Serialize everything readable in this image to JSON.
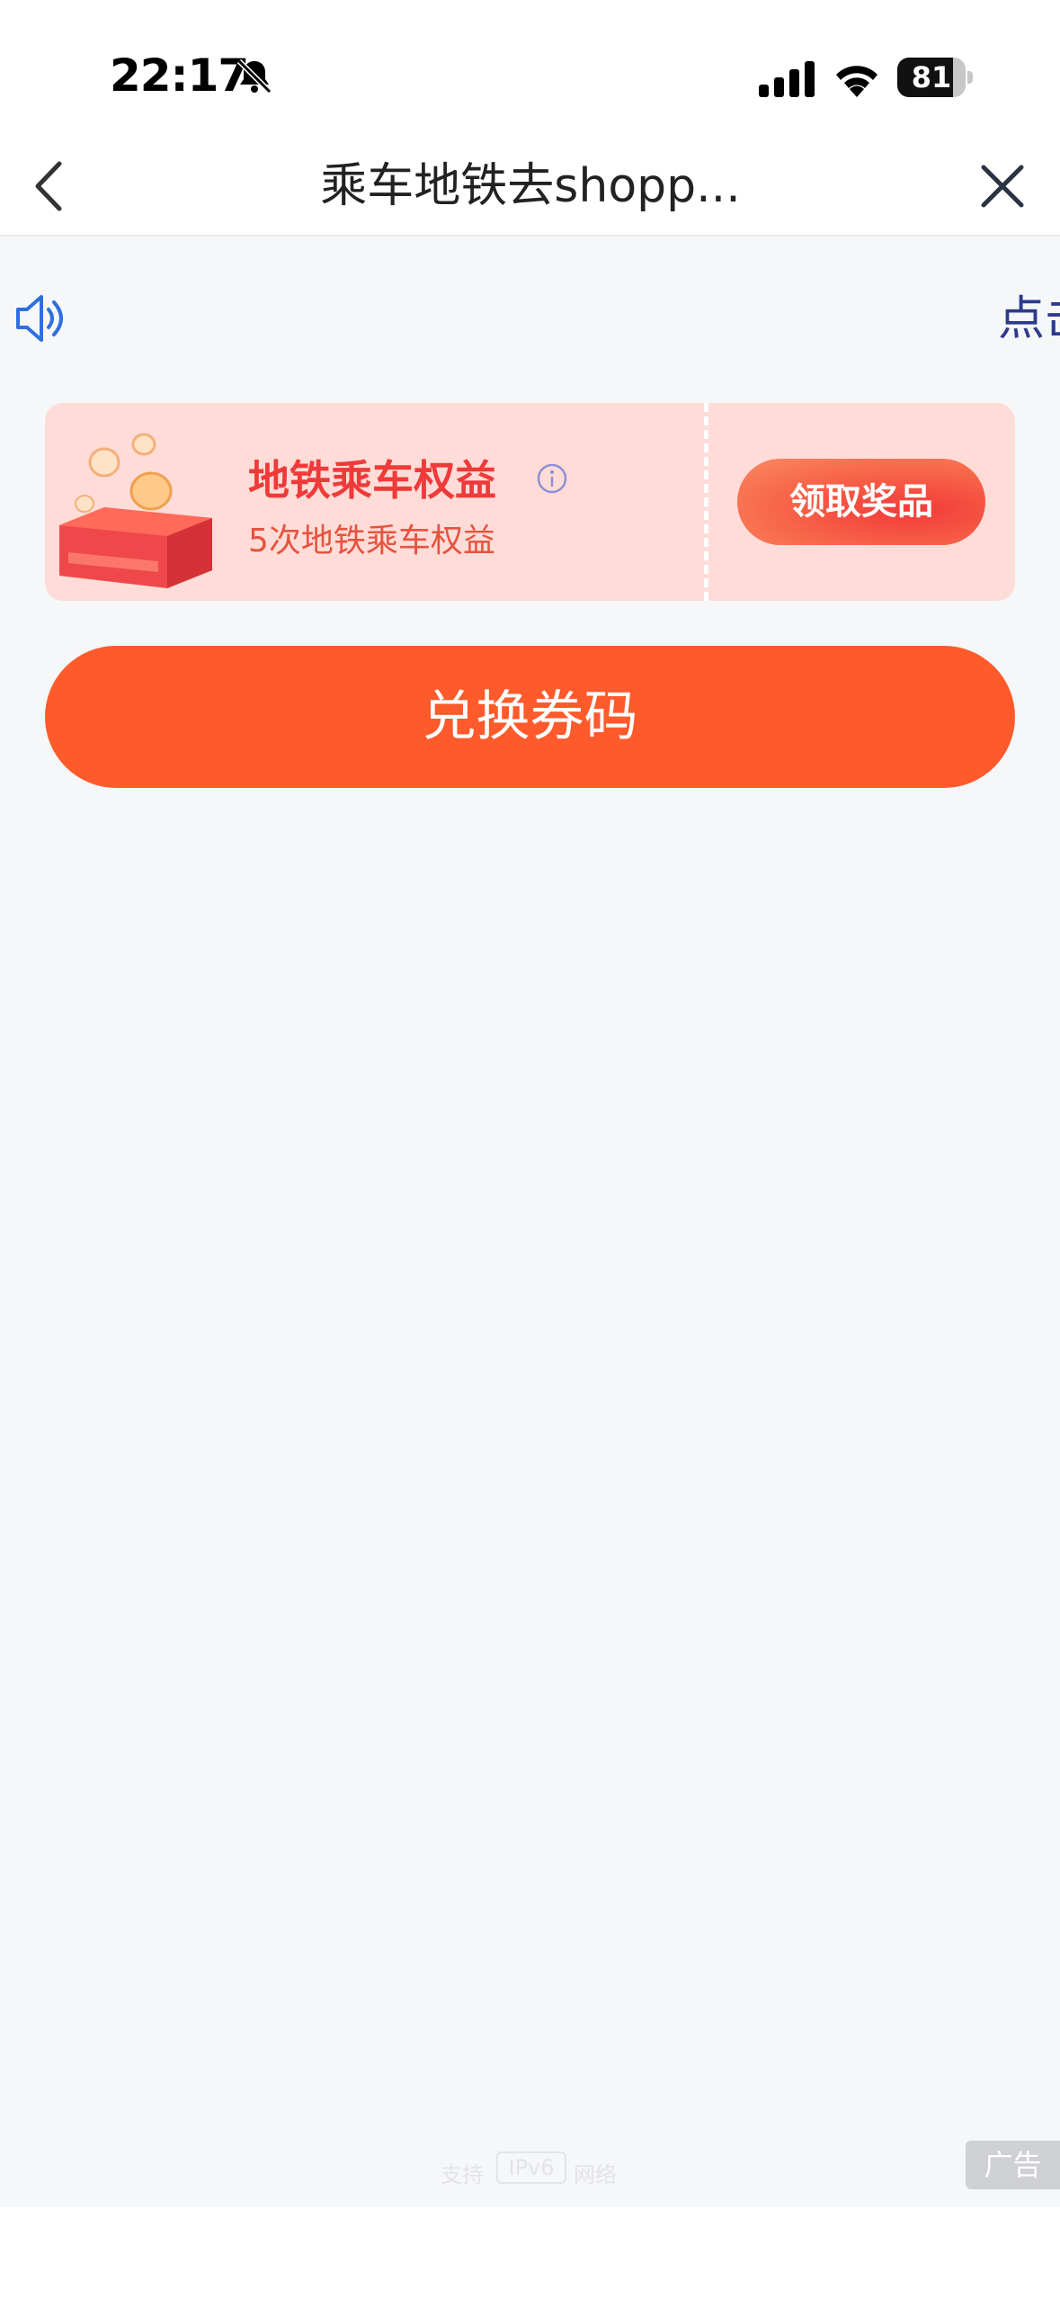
{
  "status_bar": {
    "time": "22:17",
    "battery_level": "81",
    "battery_fraction": 0.81,
    "icons": [
      "bell-slash-icon",
      "cellular-signal-icon",
      "wifi-icon",
      "battery-icon"
    ]
  },
  "nav": {
    "title": "乘车地铁去shopp...",
    "back_icon": "chevron-left-icon",
    "close_icon": "close-icon"
  },
  "notice": {
    "icon": "speaker-icon",
    "text": "点击"
  },
  "reward_card": {
    "title": "地铁乘车权益",
    "subtitle": "5次地铁乘车权益",
    "claim_label": "领取奖品",
    "info_icon": "info-icon",
    "illustration": "red-wallet-coins-illustration"
  },
  "redeem_button": {
    "label": "兑换券码"
  },
  "footer": {
    "ipv6_prefix": "支持",
    "ipv6_label": "IPv6",
    "ipv6_suffix": "网络"
  },
  "ad_badge": "广告",
  "colors": {
    "background": "#f6f7f9",
    "accent": "#ff5a2b",
    "card_bg": "#ffdcd7",
    "card_title": "#ef3a3a",
    "notice_text": "#2d3a8c",
    "speaker": "#2f6fe0"
  }
}
